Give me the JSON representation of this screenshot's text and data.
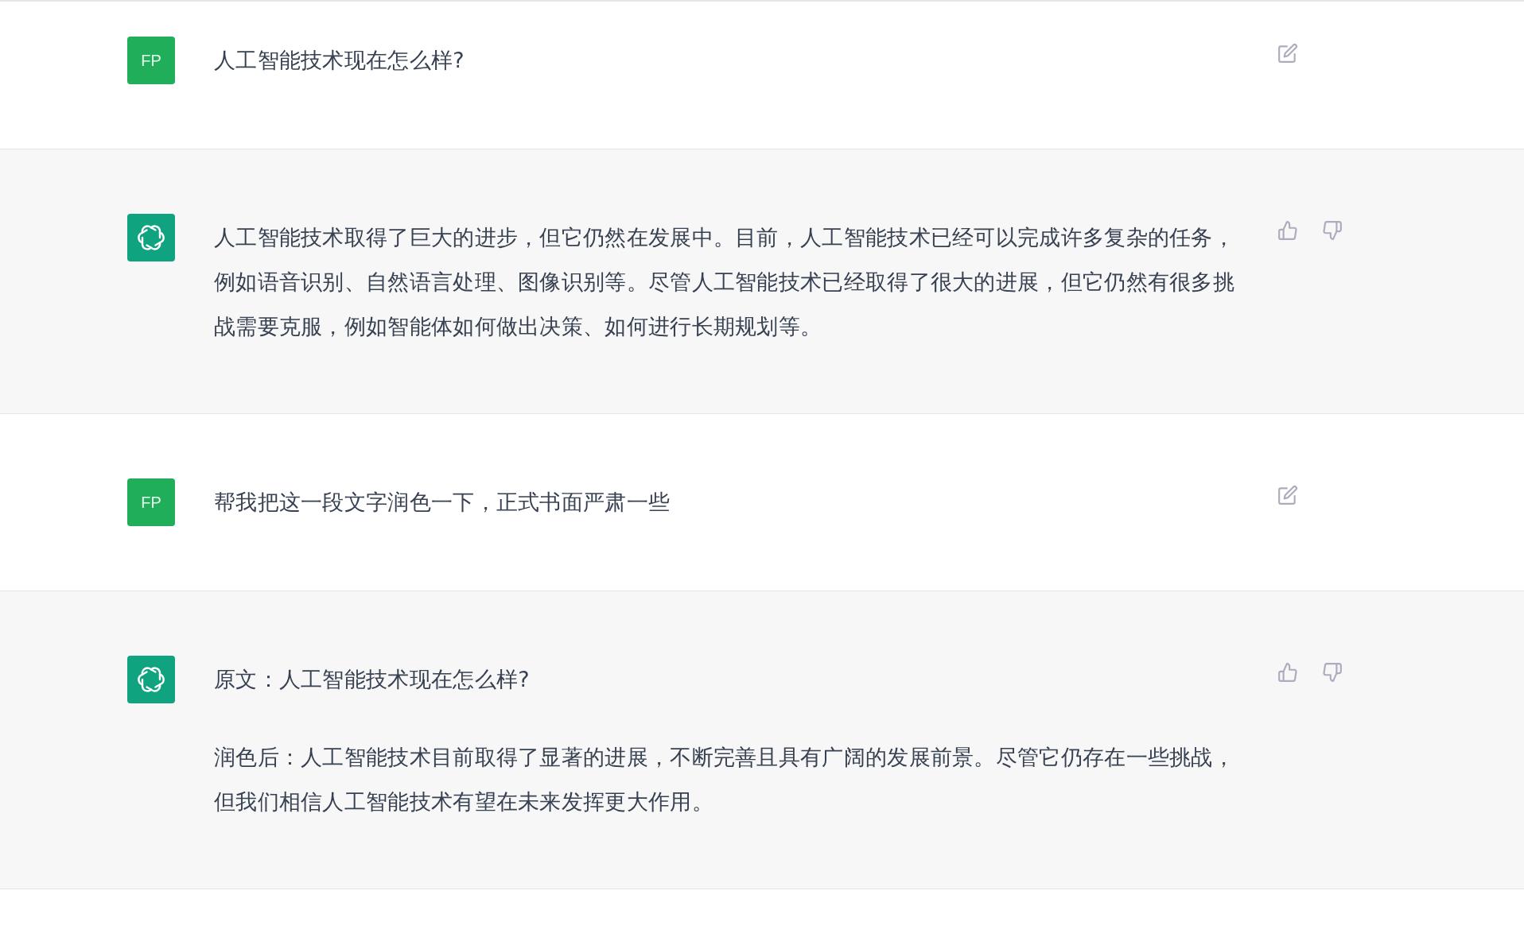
{
  "messages": [
    {
      "kind": "user",
      "avatar": "FP",
      "paragraphs": [
        "人工智能技术现在怎么样?"
      ]
    },
    {
      "kind": "assistant",
      "paragraphs": [
        "人工智能技术取得了巨大的进步，但它仍然在发展中。目前，人工智能技术已经可以完成许多复杂的任务，例如语音识别、自然语言处理、图像识别等。尽管人工智能技术已经取得了很大的进展，但它仍然有很多挑战需要克服，例如智能体如何做出决策、如何进行长期规划等。"
      ]
    },
    {
      "kind": "user",
      "avatar": "FP",
      "paragraphs": [
        "帮我把这一段文字润色一下，正式书面严肃一些"
      ]
    },
    {
      "kind": "assistant",
      "paragraphs": [
        "原文：人工智能技术现在怎么样?",
        "润色后：人工智能技术目前取得了显著的进展，不断完善且具有广阔的发展前景。尽管它仍存在一些挑战，但我们相信人工智能技术有望在未来发挥更大作用。"
      ]
    }
  ]
}
